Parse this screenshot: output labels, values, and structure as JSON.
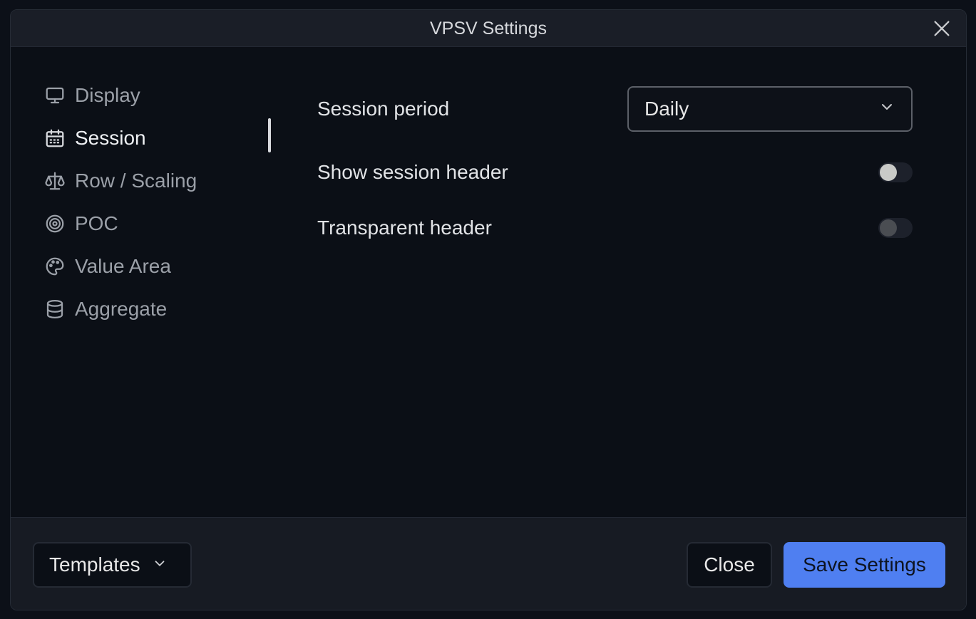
{
  "dialog": {
    "title": "VPSV Settings",
    "close_icon": "close-icon"
  },
  "sidebar": {
    "active": "Session",
    "items": [
      {
        "label": "Display",
        "icon": "monitor-icon"
      },
      {
        "label": "Session",
        "icon": "calendar-icon"
      },
      {
        "label": "Row / Scaling",
        "icon": "scale-icon"
      },
      {
        "label": "POC",
        "icon": "target-icon"
      },
      {
        "label": "Value Area",
        "icon": "palette-icon"
      },
      {
        "label": "Aggregate",
        "icon": "database-icon"
      }
    ]
  },
  "session": {
    "period_label": "Session period",
    "period_value": "Daily",
    "show_header_label": "Show session header",
    "show_header_on": false,
    "transparent_header_label": "Transparent header",
    "transparent_header_on": false
  },
  "footer": {
    "templates_label": "Templates",
    "close_label": "Close",
    "save_label": "Save Settings"
  },
  "colors": {
    "accent": "#4f7ff1",
    "background": "#0b0f16",
    "titlebar": "#1a1e27"
  }
}
